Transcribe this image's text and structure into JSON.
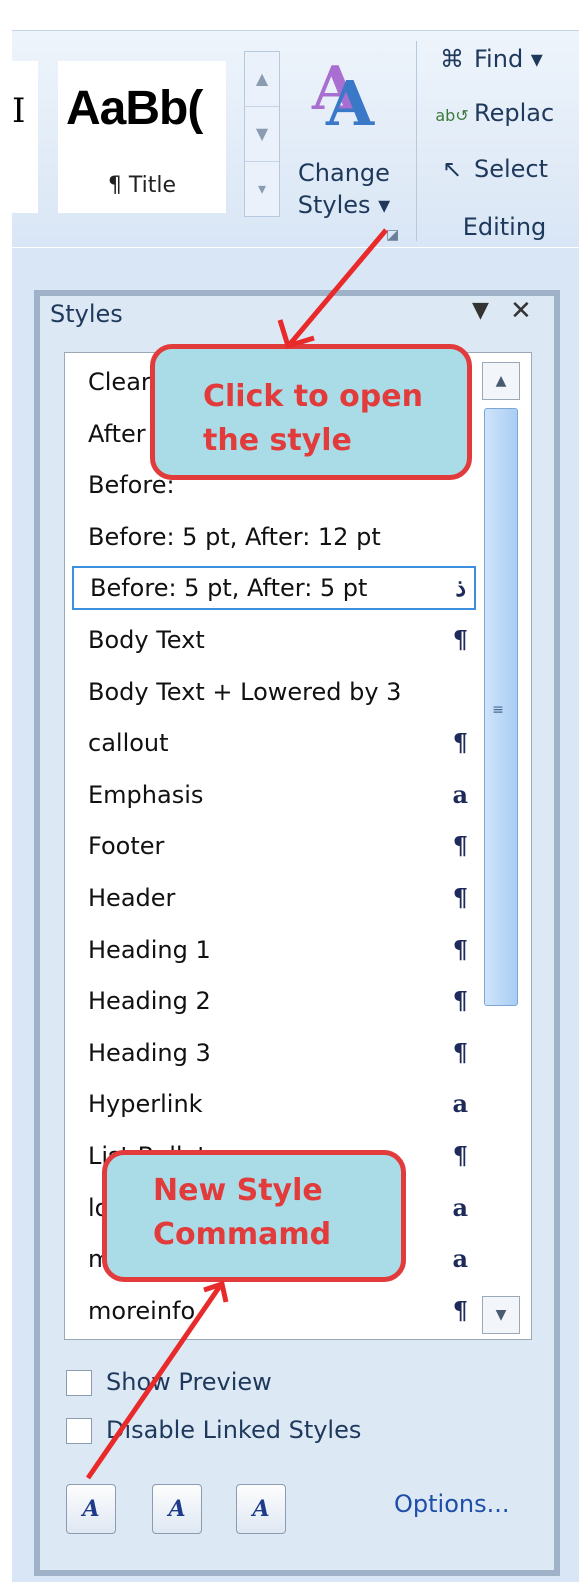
{
  "ribbon": {
    "gallery_partial_text": "I",
    "gallery_sample": "AaBb(",
    "gallery_label": "¶ Title",
    "change_styles": [
      "Change",
      "Styles ▾"
    ],
    "editing": {
      "find": "Find ▾",
      "replace": "Replac",
      "select": "Select",
      "group_label": "Editing"
    }
  },
  "styles_pane": {
    "title": "Styles",
    "menu_glyph": "▼",
    "close_glyph": "✕",
    "items": [
      {
        "name": "Clear",
        "mark": ""
      },
      {
        "name": "After",
        "mark": ""
      },
      {
        "name": "Before:",
        "mark": ""
      },
      {
        "name": "Before:  5 pt, After:  12 pt",
        "mark": ""
      },
      {
        "name": "Before:  5 pt, After:  5 pt",
        "mark": "ذ"
      },
      {
        "name": "Body Text",
        "mark": "¶"
      },
      {
        "name": "Body Text + Lowered by  3",
        "mark": ""
      },
      {
        "name": "callout",
        "mark": "¶"
      },
      {
        "name": "Emphasis",
        "mark": "a"
      },
      {
        "name": "Footer",
        "mark": "¶"
      },
      {
        "name": "Header",
        "mark": "¶"
      },
      {
        "name": "Heading 1",
        "mark": "¶"
      },
      {
        "name": "Heading 2",
        "mark": "¶"
      },
      {
        "name": "Heading 3",
        "mark": "¶"
      },
      {
        "name": "Hyperlink",
        "mark": "a"
      },
      {
        "name": "List Bullet",
        "mark": "¶"
      },
      {
        "name": "lo",
        "mark": "a"
      },
      {
        "name": "m",
        "mark": "a"
      },
      {
        "name": "moreinfo",
        "mark": "¶"
      }
    ],
    "selected_index": 4,
    "show_preview": "Show Preview",
    "disable_linked": "Disable Linked Styles",
    "options": "Options..."
  },
  "callouts": {
    "open_line1": "Click to open",
    "open_line2": "the style",
    "new_line1": "New Style",
    "new_line2": "Commamd"
  },
  "colors": {
    "callout_fill": "#a9dce6",
    "callout_border": "#e23b3b",
    "selected_border": "#3d8fe0"
  }
}
